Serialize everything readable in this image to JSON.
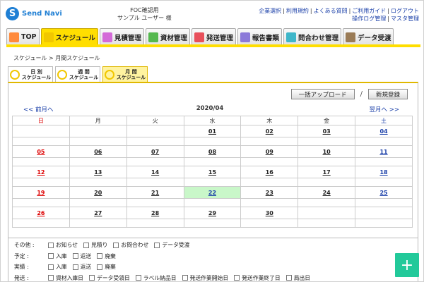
{
  "header": {
    "logo_glyph": "S",
    "logo_text": "Send Navi",
    "company_line1": "FOC確認用",
    "company_line2": "サンプル ユーザー 様",
    "links_row1": [
      "企業選択",
      "利用規約",
      "よくある質問",
      "ご利用ガイド",
      "ログアウト"
    ],
    "links_row2": [
      "操作ログ管理",
      "マスタ管理"
    ]
  },
  "tabs": [
    {
      "label": "TOP",
      "icon": "home-icon",
      "color": "#ff8a3c",
      "active": false
    },
    {
      "label": "スケジュール",
      "icon": "schedule-icon",
      "color": "#f1c700",
      "active": true
    },
    {
      "label": "見積管理",
      "icon": "estimate-icon",
      "color": "#d46ad8",
      "active": false
    },
    {
      "label": "資材管理",
      "icon": "materials-icon",
      "color": "#55b84f",
      "active": false
    },
    {
      "label": "発送管理",
      "icon": "shipping-icon",
      "color": "#e8505b",
      "active": false
    },
    {
      "label": "報告書類",
      "icon": "report-icon",
      "color": "#8c7ad9",
      "active": false
    },
    {
      "label": "問合わせ管理",
      "icon": "inquiry-icon",
      "color": "#3fb6c9",
      "active": false
    },
    {
      "label": "データ受渡",
      "icon": "data-transfer-icon",
      "color": "#9a7b56",
      "active": false
    }
  ],
  "breadcrumb": "スケジュール > 月間スケジュール",
  "subtabs": [
    {
      "line1": "日 別",
      "line2": "スケジュール",
      "active": false
    },
    {
      "line1": "週 間",
      "line2": "スケジュール",
      "active": false
    },
    {
      "line1": "月 間",
      "line2": "スケジュール",
      "active": true
    }
  ],
  "actions": {
    "bulk_upload": "一括アップロード",
    "separator": "/",
    "new_register": "新規登録"
  },
  "calendar": {
    "prev_label": "<< 前月へ",
    "title": "2020/04",
    "next_label": "翌月へ >>",
    "weekdays": [
      "日",
      "月",
      "火",
      "水",
      "木",
      "金",
      "土"
    ],
    "weeks": [
      [
        "",
        "",
        "",
        "01",
        "02",
        "03",
        "04"
      ],
      [
        "05",
        "06",
        "07",
        "08",
        "09",
        "10",
        "11"
      ],
      [
        "12",
        "13",
        "14",
        "15",
        "16",
        "17",
        "18"
      ],
      [
        "19",
        "20",
        "21",
        "22",
        "23",
        "24",
        "25"
      ],
      [
        "26",
        "27",
        "28",
        "29",
        "30",
        "",
        ""
      ]
    ],
    "today": "22"
  },
  "filters": [
    {
      "label": "その他 :",
      "options": [
        "お知らせ",
        "見積り",
        "お問合わせ",
        "データ受渡"
      ]
    },
    {
      "label": "予定  :",
      "options": [
        "入庫",
        "返送",
        "廃棄"
      ]
    },
    {
      "label": "実績  :",
      "options": [
        "入庫",
        "返送",
        "廃棄"
      ]
    },
    {
      "label": "発送  :",
      "options": [
        "資材入庫日",
        "データ受領日",
        "ラベル納品日",
        "発送作業開始日",
        "発送作業終了日",
        "局出日"
      ]
    }
  ],
  "fab_glyph": "+",
  "colors": {
    "accent": "#ffde00",
    "link": "#1a3fa8",
    "sunday": "#dd0000",
    "today_bg": "#c9f7c9",
    "fab": "#22c99a"
  }
}
